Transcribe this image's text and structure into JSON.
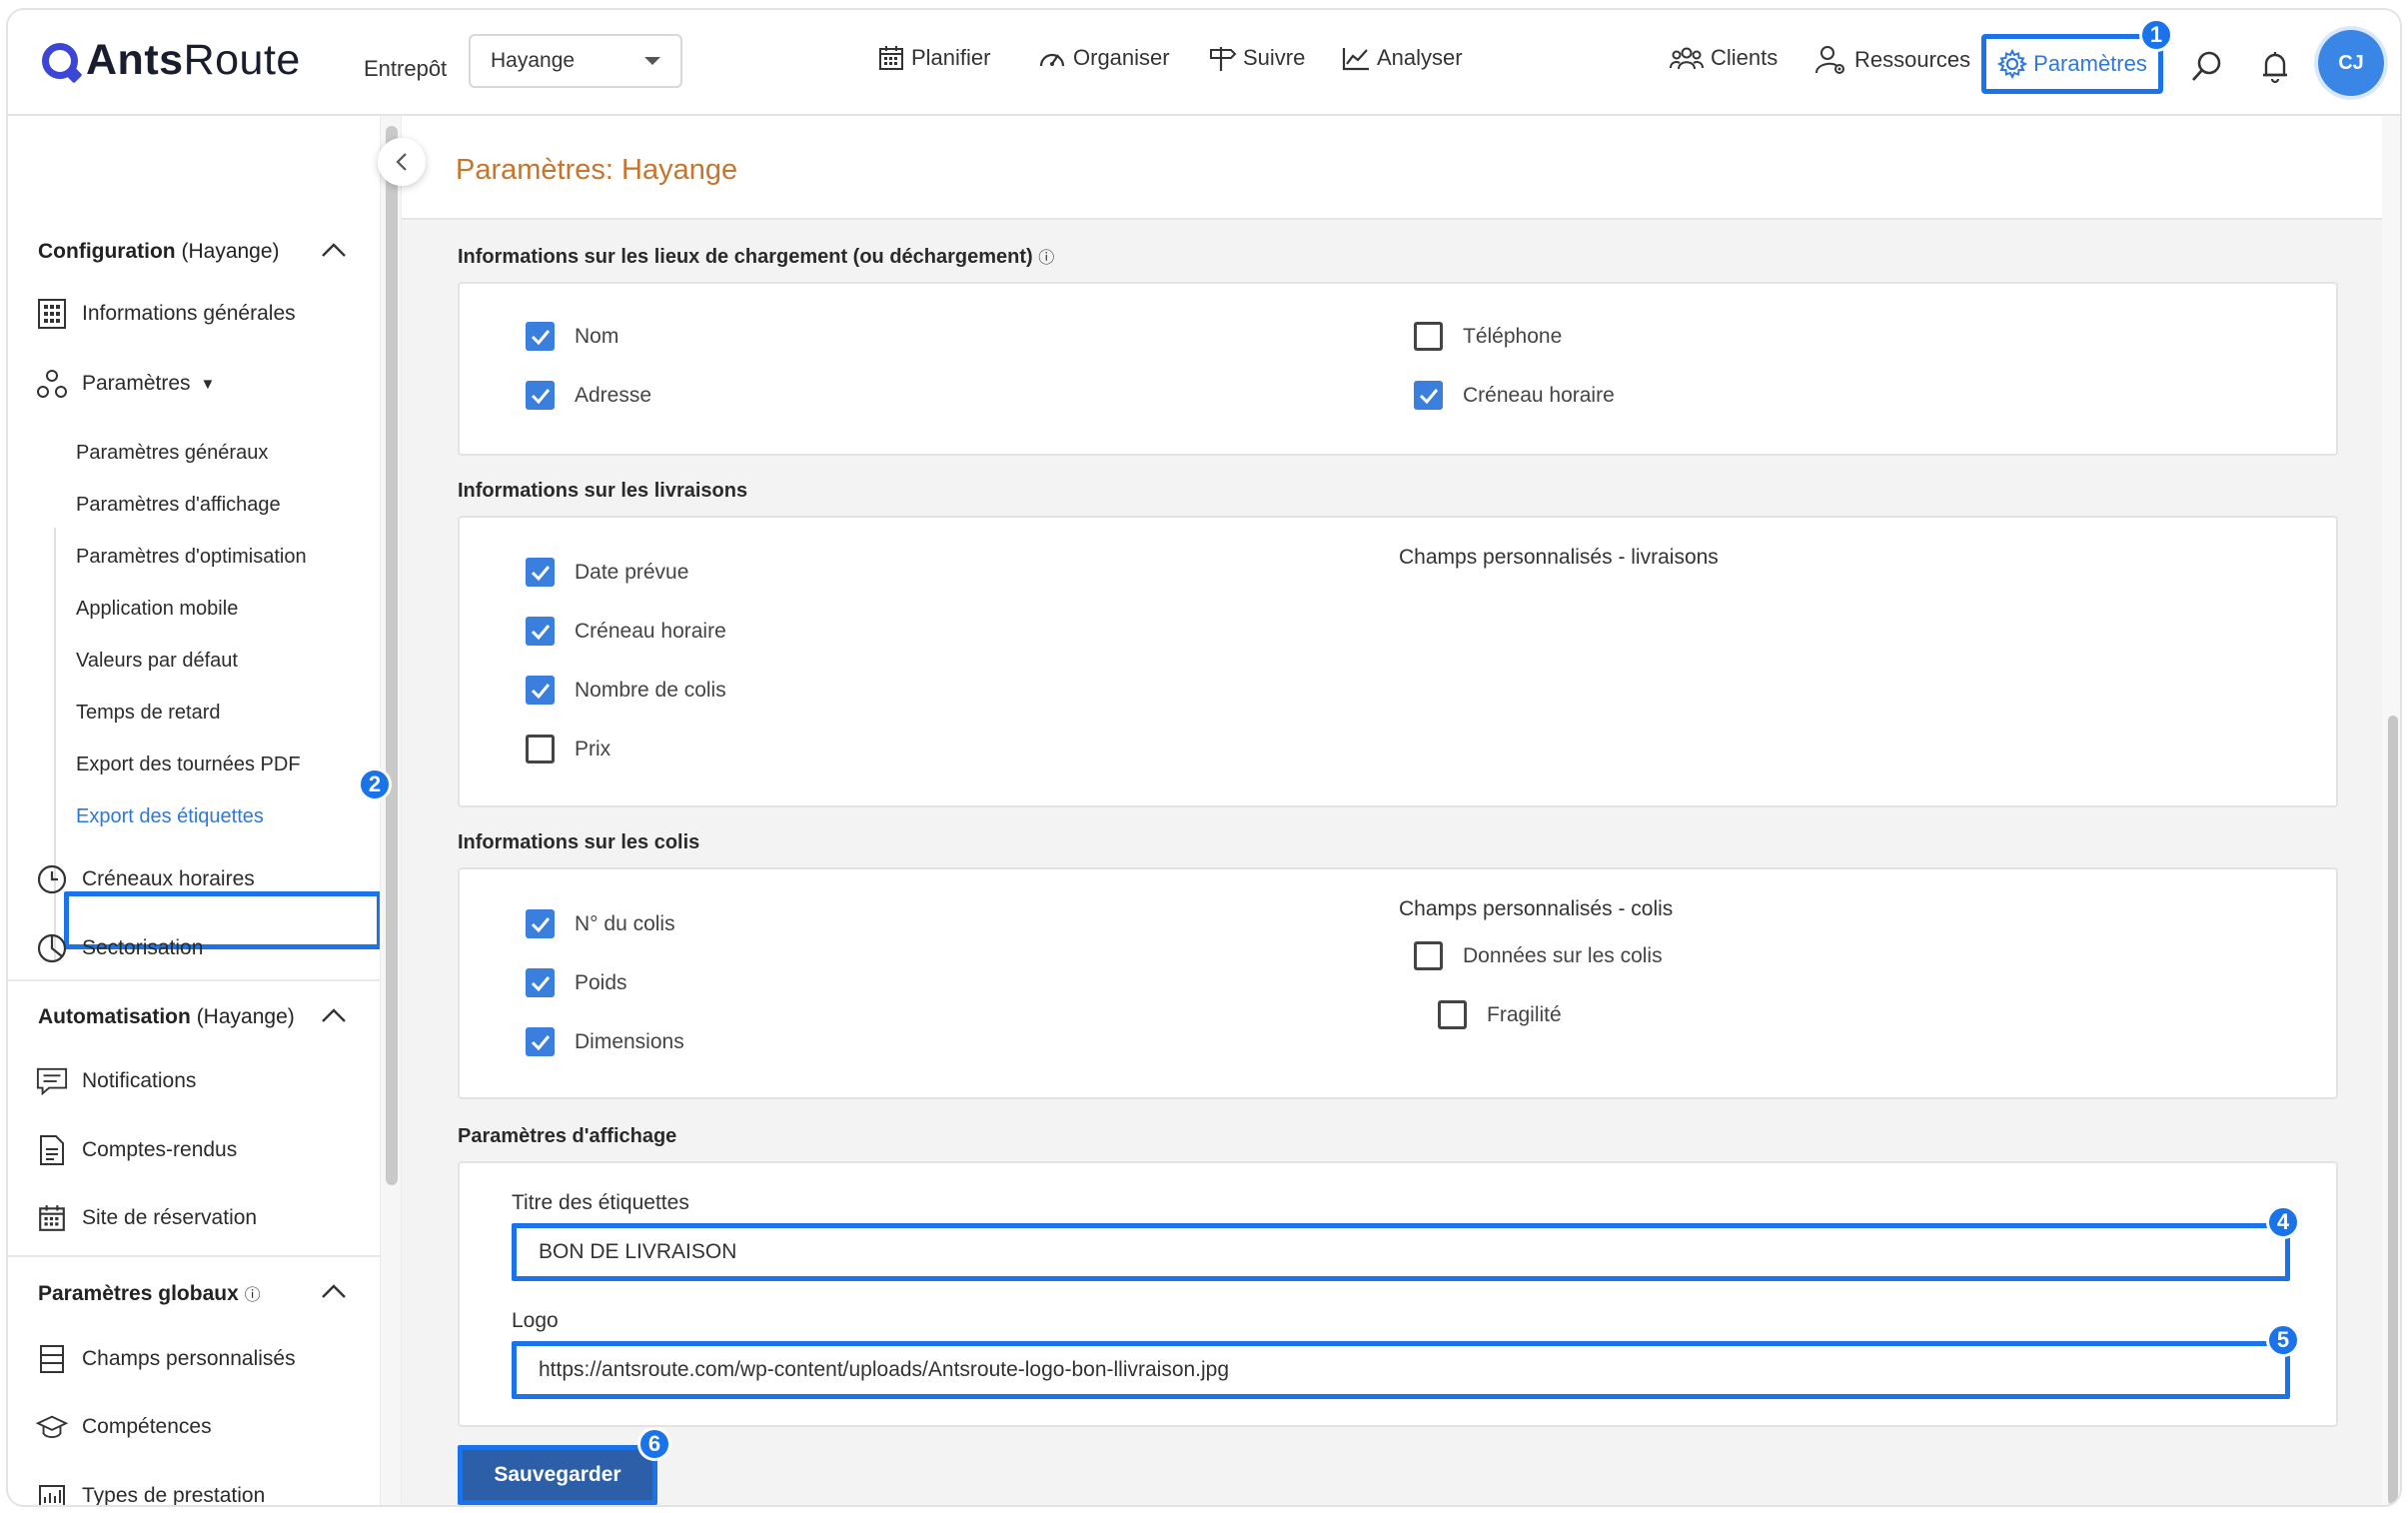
{
  "app": {
    "logo_bold": "Ants",
    "logo_light": "Route",
    "avatar_initials": "CJ"
  },
  "header": {
    "entrepot_label": "Entrepôt",
    "entrepot_value": "Hayange",
    "nav": [
      "Planifier",
      "Organiser",
      "Suivre",
      "Analyser"
    ],
    "right_nav": [
      "Clients",
      "Ressources",
      "Paramètres"
    ]
  },
  "badges": [
    "1",
    "2",
    "4",
    "5",
    "6"
  ],
  "sidebar": {
    "config_title": "Configuration",
    "config_scope": "(Hayange)",
    "items_top": [
      "Informations générales",
      "Paramètres"
    ],
    "sub_items": [
      "Paramètres généraux",
      "Paramètres d'affichage",
      "Paramètres d'optimisation",
      "Application mobile",
      "Valeurs par défaut",
      "Temps de retard",
      "Export des tournées PDF",
      "Export des étiquettes"
    ],
    "items_after": [
      "Créneaux horaires",
      "Sectorisation"
    ],
    "auto_title": "Automatisation",
    "auto_scope": "(Hayange)",
    "auto_items": [
      "Notifications",
      "Comptes-rendus",
      "Site de réservation"
    ],
    "global_title": "Paramètres globaux",
    "global_items": [
      "Champs personnalisés",
      "Compétences",
      "Types de prestation"
    ]
  },
  "page": {
    "title": "Paramètres: Hayange",
    "groups": {
      "lieux": {
        "title": "Informations sur les lieux de chargement (ou déchargement)",
        "fields": [
          {
            "label": "Nom",
            "checked": true
          },
          {
            "label": "Adresse",
            "checked": true
          },
          {
            "label": "Téléphone",
            "checked": false
          },
          {
            "label": "Créneau horaire",
            "checked": true
          }
        ]
      },
      "livraisons": {
        "title": "Informations sur les livraisons",
        "fields": [
          {
            "label": "Date prévue",
            "checked": true
          },
          {
            "label": "Créneau horaire",
            "checked": true
          },
          {
            "label": "Nombre de colis",
            "checked": true
          },
          {
            "label": "Prix",
            "checked": false
          }
        ],
        "custom_title": "Champs personnalisés - livraisons"
      },
      "colis": {
        "title": "Informations sur les colis",
        "fields": [
          {
            "label": "N° du colis",
            "checked": true
          },
          {
            "label": "Poids",
            "checked": true
          },
          {
            "label": "Dimensions",
            "checked": true
          }
        ],
        "custom_title": "Champs personnalisés - colis",
        "custom_fields": [
          {
            "label": "Données sur les colis",
            "checked": false
          },
          {
            "label": "Fragilité",
            "checked": false
          }
        ]
      },
      "affichage": {
        "title": "Paramètres d'affichage",
        "titre_label": "Titre des étiquettes",
        "titre_value": "BON DE LIVRAISON",
        "logo_label": "Logo",
        "logo_value": "https://antsroute.com/wp-content/uploads/Antsroute-logo-bon-llivraison.jpg"
      }
    },
    "save_label": "Sauvegarder"
  },
  "colors": {
    "accent": "#1a73e8",
    "checkbox": "#3a7fdd",
    "title": "#c9742b",
    "save": "#2d5fa8"
  }
}
